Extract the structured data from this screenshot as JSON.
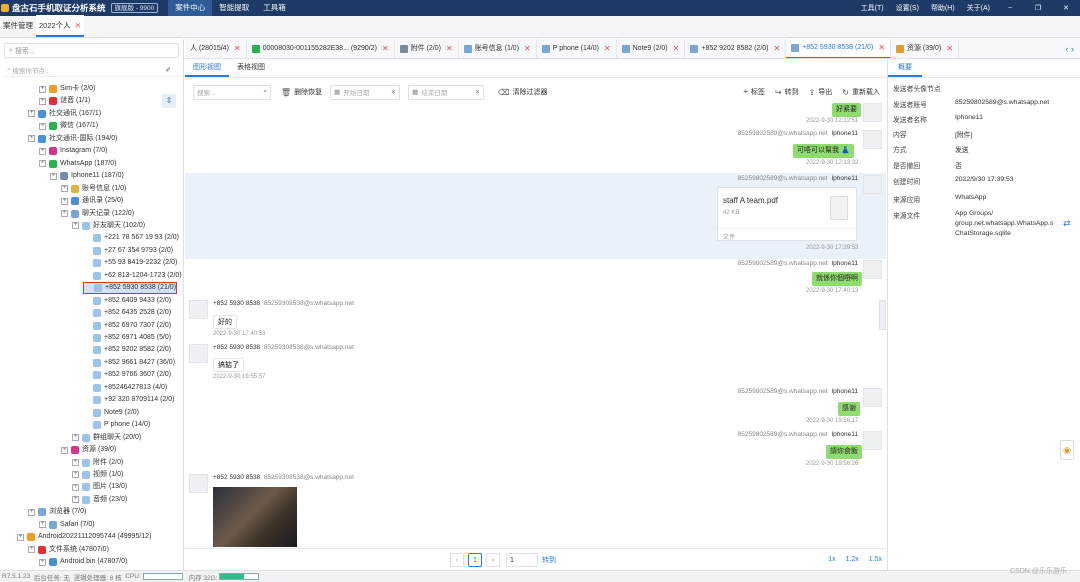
{
  "app": {
    "title": "盘古石手机取证分析系统",
    "edition": "旗舰版 - 9900",
    "menus": [
      "案件中心",
      "智能提取",
      "工具箱"
    ],
    "right_menus": [
      "工具(T)",
      "设置(S)",
      "帮助(H)",
      "关于(A)"
    ]
  },
  "case_tabs": [
    "案件管理",
    "2022个人"
  ],
  "left": {
    "search_placeholder": "搜索...",
    "filter_placeholder": "搜索你节点..."
  },
  "tree": [
    {
      "label": "Sim卡 (2/0)",
      "indent": 3
    },
    {
      "label": "谜音 (1/1)",
      "indent": 3
    },
    {
      "label": "社交通讯 (167/1)",
      "indent": 2
    },
    {
      "label": "微信 (167/1)",
      "indent": 3
    },
    {
      "label": "社交通讯-国际 (194/0)",
      "indent": 2
    },
    {
      "label": "Instagram (7/0)",
      "indent": 3
    },
    {
      "label": "WhatsApp (187/0)",
      "indent": 3
    },
    {
      "label": "Iphone11 (187/0)",
      "indent": 4
    },
    {
      "label": "账号信息 (1/0)",
      "indent": 5
    },
    {
      "label": "通讯录 (25/0)",
      "indent": 5
    },
    {
      "label": "聊天记录 (122/0)",
      "indent": 5
    },
    {
      "label": "好友聊天 (102/0)",
      "indent": 6
    },
    {
      "label": "+221 78 567 19 93 (2/0)",
      "indent": 7
    },
    {
      "label": "+27 67 354 9793 (2/0)",
      "indent": 7
    },
    {
      "label": "+55 93 8419-2232 (2/0)",
      "indent": 7
    },
    {
      "label": "+62 813-1204-1723 (2/0)",
      "indent": 7
    },
    {
      "label": "+852 5930 8538 (21/0)",
      "indent": 7
    },
    {
      "label": "+852 6409 9433 (2/0)",
      "indent": 7
    },
    {
      "label": "+852 6435 2528 (2/0)",
      "indent": 7
    },
    {
      "label": "+852 6970 7307 (2/0)",
      "indent": 7
    },
    {
      "label": "+852 6971 4085 (5/0)",
      "indent": 7
    },
    {
      "label": "+852 9202 8582 (2/0)",
      "indent": 7
    },
    {
      "label": "+852 9661 8427 (36/0)",
      "indent": 7
    },
    {
      "label": "+852 9766 3607 (2/0)",
      "indent": 7
    },
    {
      "label": "+85246427813 (4/0)",
      "indent": 7
    },
    {
      "label": "+92 320 8709114 (2/0)",
      "indent": 7
    },
    {
      "label": "Note9 (2/0)",
      "indent": 7
    },
    {
      "label": "P phone (14/0)",
      "indent": 7
    },
    {
      "label": "群组聊天 (20/0)",
      "indent": 6
    },
    {
      "label": "资源 (39/0)",
      "indent": 5
    },
    {
      "label": "附件 (2/0)",
      "indent": 6
    },
    {
      "label": "视频 (1/0)",
      "indent": 6
    },
    {
      "label": "图片 (13/0)",
      "indent": 6
    },
    {
      "label": "音频 (23/0)",
      "indent": 6
    },
    {
      "label": "浏览器 (7/0)",
      "indent": 2
    },
    {
      "label": "Safari (7/0)",
      "indent": 3
    },
    {
      "label": "Android20221112095744 (49995/12)",
      "indent": 1
    },
    {
      "label": "文件系统 (47807/0)",
      "indent": 2
    },
    {
      "label": "Android.bin (47807/0)",
      "indent": 3
    }
  ],
  "doc_tabs": [
    "人 (28015/4)",
    "00008030-001155282E38... (9290/2)",
    "附件 (2/0)",
    "账号信息 (1/0)",
    "P phone (14/0)",
    "Note9 (2/0)",
    "+852 9202 8582 (2/0)",
    "+852 5930 8538 (21/0)",
    "资源 (39/0)"
  ],
  "view_tabs": [
    "图形视图",
    "表格视图"
  ],
  "toolbar": {
    "search_placeholder": "搜索...",
    "delete_restore": "删除恢复",
    "start_date": "开始日期",
    "end_date": "结束日期",
    "clear_filter": "清除过滤器",
    "tag": "标签",
    "forward": "转到",
    "export": "导出",
    "reload": "重新载入"
  },
  "messages": [
    {
      "side": "out",
      "text": "好紧要",
      "time": "2022-9-30 12:12:51"
    },
    {
      "side": "out",
      "sender": "85259802589@s.whatsapp.net",
      "name": "Iphone11",
      "text": "可唔可以幫我 👗",
      "time": "2022-9-30 12:13:32"
    },
    {
      "side": "out",
      "sender": "85259802589@s.whatsapp.net",
      "name": "Iphone11",
      "file": {
        "name": "staff A team.pdf",
        "size": "42 KB",
        "kind": "文件"
      },
      "time": "2022-9-30 17:39:53"
    },
    {
      "side": "out",
      "sender": "85259802589@s.whatsapp.net",
      "name": "Iphone11",
      "text": "就係你個嘢啊",
      "time": "2022-9-30 17:40:13"
    },
    {
      "side": "in",
      "name": "+852 5930 8538",
      "sender": "85259308538@s.whatsapp.net",
      "text": "好的",
      "time": "2022-9-30 17:40:53"
    },
    {
      "side": "in",
      "name": "+852 5930 8538",
      "sender": "85259308538@s.whatsapp.net",
      "text": "搞掂了",
      "time": "2022-9-30 19:55:57"
    },
    {
      "side": "out",
      "sender": "85259802589@s.whatsapp.net",
      "name": "Iphone11",
      "text": "感谢",
      "time": "2022-9-30 19:56:17"
    },
    {
      "side": "out",
      "sender": "85259802589@s.whatsapp.net",
      "name": "Iphone11",
      "text": "請你食飯",
      "time": "2022-9-30 19:56:26"
    },
    {
      "side": "in",
      "name": "+852 5930 8538",
      "sender": "85259308538@s.whatsapp.net",
      "text": "",
      "time": ""
    }
  ],
  "pager": {
    "prev": "‹",
    "current": "1",
    "next": "›",
    "input": "1",
    "go": "转到",
    "zooms": [
      "1x",
      "1.2x",
      "1.5x"
    ]
  },
  "right": {
    "header": "概要",
    "props": [
      {
        "k": "发送者头像节点",
        "v": ""
      },
      {
        "k": "发送者账号",
        "v": "85259802589@s.whatsapp.net"
      },
      {
        "k": "发送者名称",
        "v": "Iphone11"
      },
      {
        "k": "内容",
        "v": "[附件]"
      },
      {
        "k": "方式",
        "v": "发送"
      },
      {
        "k": "是否撤回",
        "v": "否"
      },
      {
        "k": "创建时间",
        "v": "2022/9/30 17:39:53"
      },
      {
        "k": "来源应用",
        "v": "WhatsApp"
      },
      {
        "k": "来源文件",
        "v": "App Groups/"
      },
      {
        "k": "",
        "v": "group.net.whatsapp.WhatsApp.s"
      },
      {
        "k": "",
        "v": "ChatStorage.sqlite"
      }
    ]
  },
  "status": {
    "version": "R7.5.1.23",
    "bg": "后台任务: 无",
    "threads": "逻辑处理器: 8 核",
    "cpu": "CPU:",
    "mem": "内存 32G:",
    "cpu_level": 0,
    "mem_level": 0.62,
    "watermark": "CSDN @乐乐游乐"
  },
  "colors": {
    "titlebar": "#1d3b66",
    "accent": "#2a7ae2",
    "bubble_out": "#8fdc6e",
    "selected_row": "#eaf1f9"
  }
}
